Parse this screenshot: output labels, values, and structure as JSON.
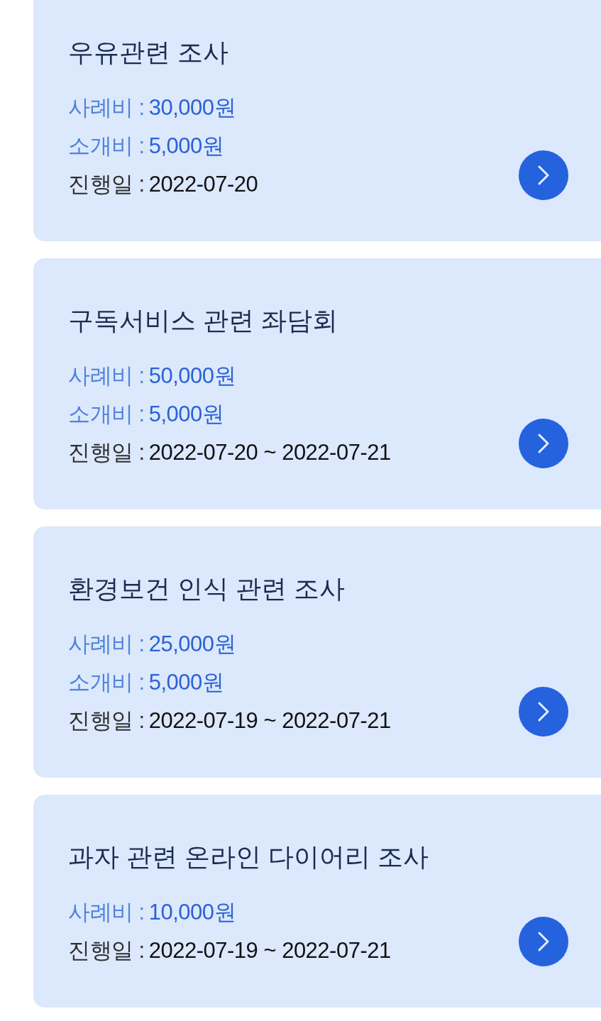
{
  "cards": [
    {
      "title": "우유관련 조사",
      "details": [
        {
          "kind": "fee",
          "label": "사례비 :",
          "value": "30,000원"
        },
        {
          "kind": "fee",
          "label": "소개비 :",
          "value": "5,000원"
        },
        {
          "kind": "date",
          "label": "진행일 :",
          "value": "2022-07-20"
        }
      ]
    },
    {
      "title": "구독서비스 관련 좌담회",
      "details": [
        {
          "kind": "fee",
          "label": "사례비 :",
          "value": "50,000원"
        },
        {
          "kind": "fee",
          "label": "소개비 :",
          "value": "5,000원"
        },
        {
          "kind": "date",
          "label": "진행일 :",
          "value": "2022-07-20 ~ 2022-07-21"
        }
      ]
    },
    {
      "title": "환경보건 인식 관련 조사",
      "details": [
        {
          "kind": "fee",
          "label": "사례비 :",
          "value": "25,000원"
        },
        {
          "kind": "fee",
          "label": "소개비 :",
          "value": "5,000원"
        },
        {
          "kind": "date",
          "label": "진행일 :",
          "value": "2022-07-19 ~ 2022-07-21"
        }
      ]
    },
    {
      "title": "과자 관련 온라인 다이어리 조사",
      "details": [
        {
          "kind": "fee",
          "label": "사례비 :",
          "value": "10,000원"
        },
        {
          "kind": "date",
          "label": "진행일 :",
          "value": "2022-07-19 ~ 2022-07-21"
        }
      ]
    }
  ]
}
